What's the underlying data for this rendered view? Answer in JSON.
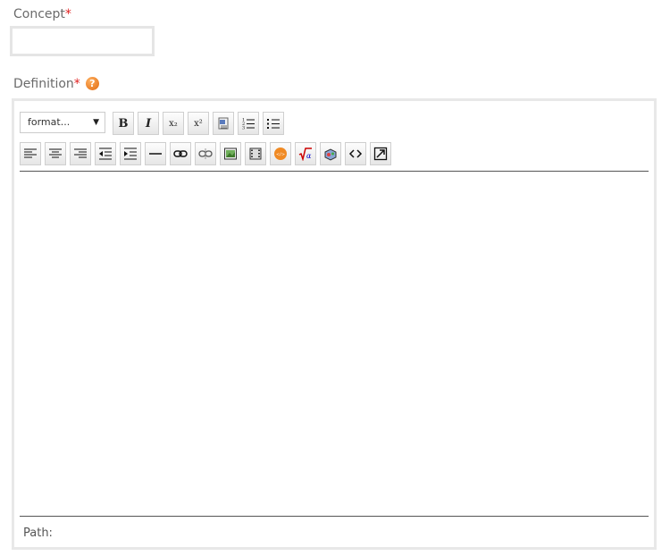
{
  "form": {
    "concept_label": "Concept",
    "required_mark": "*",
    "concept_value": "",
    "definition_label": "Definition",
    "help_icon_glyph": "?"
  },
  "editor": {
    "format_select_value": "format...",
    "format_arrow": "▼",
    "path_label": "Path:",
    "toolbar_row1": [
      {
        "name": "bold-button",
        "icon": "bold-icon",
        "glyph": "B"
      },
      {
        "name": "italic-button",
        "icon": "italic-icon",
        "glyph": "I"
      },
      {
        "name": "subscript-button",
        "icon": "subscript-icon",
        "glyph": "x₂"
      },
      {
        "name": "superscript-button",
        "icon": "superscript-icon",
        "glyph": "x²"
      },
      {
        "name": "paste-word-button",
        "icon": "paste-word-icon",
        "glyph": ""
      },
      {
        "name": "ordered-list-button",
        "icon": "ordered-list-icon",
        "glyph": ""
      },
      {
        "name": "unordered-list-button",
        "icon": "unordered-list-icon",
        "glyph": ""
      }
    ],
    "toolbar_row2": [
      {
        "name": "align-left-button",
        "icon": "align-left-icon"
      },
      {
        "name": "align-center-button",
        "icon": "align-center-icon"
      },
      {
        "name": "align-right-button",
        "icon": "align-right-icon"
      },
      {
        "name": "outdent-button",
        "icon": "outdent-icon"
      },
      {
        "name": "indent-button",
        "icon": "indent-icon"
      },
      {
        "name": "horizontal-rule-button",
        "icon": "horizontal-rule-icon"
      },
      {
        "name": "insert-link-button",
        "icon": "link-icon"
      },
      {
        "name": "unlink-button",
        "icon": "unlink-icon"
      },
      {
        "name": "insert-image-button",
        "icon": "image-icon"
      },
      {
        "name": "insert-media-button",
        "icon": "media-icon"
      },
      {
        "name": "embed-code-button",
        "icon": "embed-code-icon"
      },
      {
        "name": "equation-button",
        "icon": "equation-icon"
      },
      {
        "name": "special-char-button",
        "icon": "special-char-icon"
      },
      {
        "name": "html-source-button",
        "icon": "html-source-icon"
      },
      {
        "name": "fullscreen-button",
        "icon": "fullscreen-icon"
      }
    ]
  }
}
